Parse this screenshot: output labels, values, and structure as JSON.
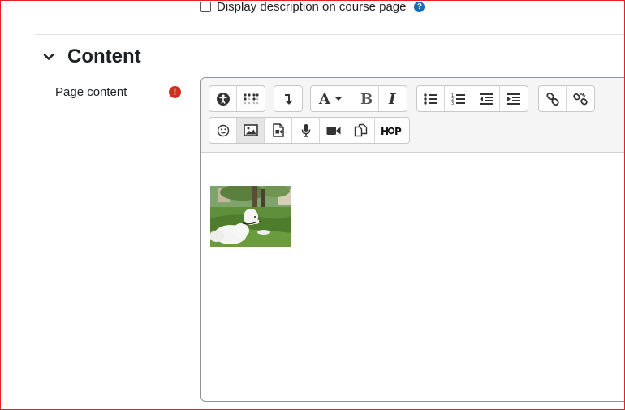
{
  "description_option": {
    "label": "Display description on course page",
    "help_icon": "question-circle-icon",
    "checked": false
  },
  "section": {
    "title": "Content",
    "expanded": true
  },
  "field": {
    "label": "Page content",
    "required_icon": "exclamation-circle-icon"
  },
  "toolbar": {
    "row1": [
      [
        "accessibility-checker-icon",
        "screenreader-helper-icon"
      ],
      [
        "collapse-toolbar-icon"
      ],
      [
        "font-style-icon",
        "bold-icon",
        "italic-icon"
      ],
      [
        "unordered-list-icon",
        "ordered-list-icon",
        "outdent-icon",
        "indent-icon"
      ],
      [
        "link-icon",
        "unlink-icon"
      ]
    ],
    "row2": [
      [
        "emoji-icon",
        "image-icon",
        "media-icon",
        "record-audio-icon",
        "record-video-icon",
        "manage-files-icon",
        "h5p-icon"
      ]
    ],
    "active_button": "image-icon"
  },
  "content": {
    "image": "dog-on-grass-photo"
  },
  "colors": {
    "accent": "#0f6cbf",
    "required": "#ca3120",
    "border_alert": "#e3212a"
  }
}
